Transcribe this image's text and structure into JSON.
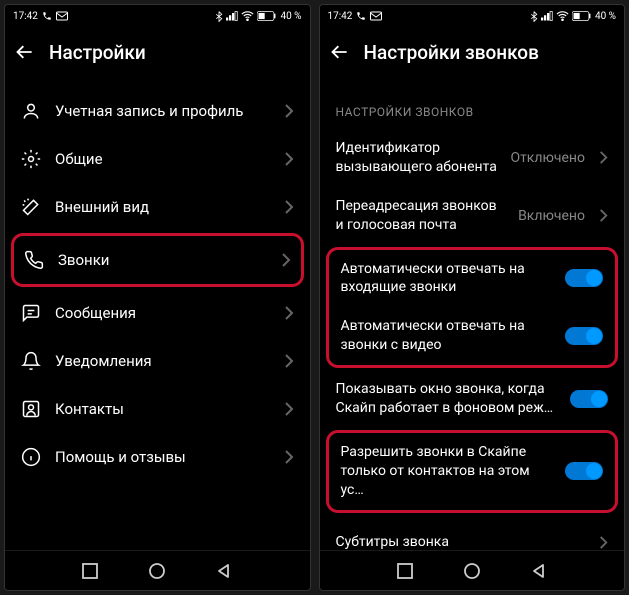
{
  "status": {
    "time": "17:42",
    "battery": "40 %"
  },
  "left": {
    "title": "Настройки",
    "items": [
      {
        "label": "Учетная запись и профиль"
      },
      {
        "label": "Общие"
      },
      {
        "label": "Внешний вид"
      },
      {
        "label": "Звонки"
      },
      {
        "label": "Сообщения"
      },
      {
        "label": "Уведомления"
      },
      {
        "label": "Контакты"
      },
      {
        "label": "Помощь и отзывы"
      }
    ]
  },
  "right": {
    "title": "Настройки звонков",
    "section": "НАСТРОЙКИ ЗВОНКОВ",
    "rows": {
      "callerId": {
        "label": "Идентификатор вызывающего абонента",
        "value": "Отключено"
      },
      "forwarding": {
        "label": "Переадресация звонков и голосовая почта",
        "value": "Включено"
      },
      "autoAnswer": {
        "label": "Автоматически отвечать на входящие звонки"
      },
      "autoAnswerVideo": {
        "label": "Автоматически отвечать на звонки с видео"
      },
      "showWindow": {
        "label": "Показывать окно звонка, когда Скайп работает в фоновом реж…"
      },
      "contactsOnly": {
        "label": "Разрешить звонки в Скайпе только от контактов на этом ус…"
      },
      "subtitles": {
        "label": "Субтитры звонка"
      }
    }
  }
}
